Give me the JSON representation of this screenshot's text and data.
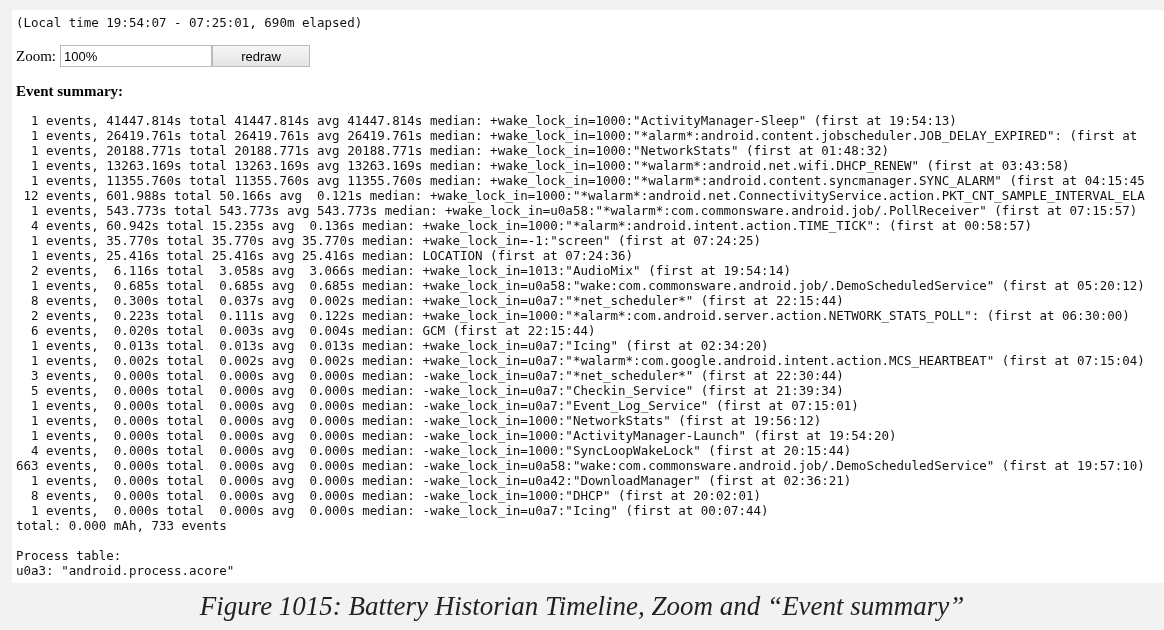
{
  "local_time": "(Local time 19:54:07 - 07:25:01, 690m elapsed)",
  "zoom": {
    "label": "Zoom:",
    "value": "100%",
    "button": "redraw"
  },
  "event_summary": {
    "heading": "Event summary:",
    "rows": [
      "  1 events, 41447.814s total 41447.814s avg 41447.814s median: +wake_lock_in=1000:\"ActivityManager-Sleep\" (first at 19:54:13)",
      "  1 events, 26419.761s total 26419.761s avg 26419.761s median: +wake_lock_in=1000:\"*alarm*:android.content.jobscheduler.JOB_DELAY_EXPIRED\": (first at",
      "  1 events, 20188.771s total 20188.771s avg 20188.771s median: +wake_lock_in=1000:\"NetworkStats\" (first at 01:48:32)",
      "  1 events, 13263.169s total 13263.169s avg 13263.169s median: +wake_lock_in=1000:\"*walarm*:android.net.wifi.DHCP_RENEW\" (first at 03:43:58)",
      "  1 events, 11355.760s total 11355.760s avg 11355.760s median: +wake_lock_in=1000:\"*walarm*:android.content.syncmanager.SYNC_ALARM\" (first at 04:15:45",
      " 12 events, 601.988s total 50.166s avg  0.121s median: +wake_lock_in=1000:\"*walarm*:android.net.ConnectivityService.action.PKT_CNT_SAMPLE_INTERVAL_ELA",
      "  1 events, 543.773s total 543.773s avg 543.773s median: +wake_lock_in=u0a58:\"*walarm*:com.commonsware.android.job/.PollReceiver\" (first at 07:15:57)",
      "  4 events, 60.942s total 15.235s avg  0.136s median: +wake_lock_in=1000:\"*alarm*:android.intent.action.TIME_TICK\": (first at 00:58:57)",
      "  1 events, 35.770s total 35.770s avg 35.770s median: +wake_lock_in=-1:\"screen\" (first at 07:24:25)",
      "  1 events, 25.416s total 25.416s avg 25.416s median: LOCATION (first at 07:24:36)",
      "  2 events,  6.116s total  3.058s avg  3.066s median: +wake_lock_in=1013:\"AudioMix\" (first at 19:54:14)",
      "  1 events,  0.685s total  0.685s avg  0.685s median: +wake_lock_in=u0a58:\"wake:com.commonsware.android.job/.DemoScheduledService\" (first at 05:20:12)",
      "  8 events,  0.300s total  0.037s avg  0.002s median: +wake_lock_in=u0a7:\"*net_scheduler*\" (first at 22:15:44)",
      "  2 events,  0.223s total  0.111s avg  0.122s median: +wake_lock_in=1000:\"*alarm*:com.android.server.action.NETWORK_STATS_POLL\": (first at 06:30:00)",
      "  6 events,  0.020s total  0.003s avg  0.004s median: GCM (first at 22:15:44)",
      "  1 events,  0.013s total  0.013s avg  0.013s median: +wake_lock_in=u0a7:\"Icing\" (first at 02:34:20)",
      "  1 events,  0.002s total  0.002s avg  0.002s median: +wake_lock_in=u0a7:\"*walarm*:com.google.android.intent.action.MCS_HEARTBEAT\" (first at 07:15:04)",
      "  3 events,  0.000s total  0.000s avg  0.000s median: -wake_lock_in=u0a7:\"*net_scheduler*\" (first at 22:30:44)",
      "  5 events,  0.000s total  0.000s avg  0.000s median: -wake_lock_in=u0a7:\"Checkin_Service\" (first at 21:39:34)",
      "  1 events,  0.000s total  0.000s avg  0.000s median: -wake_lock_in=u0a7:\"Event_Log_Service\" (first at 07:15:01)",
      "  1 events,  0.000s total  0.000s avg  0.000s median: -wake_lock_in=1000:\"NetworkStats\" (first at 19:56:12)",
      "  1 events,  0.000s total  0.000s avg  0.000s median: -wake_lock_in=1000:\"ActivityManager-Launch\" (first at 19:54:20)",
      "  4 events,  0.000s total  0.000s avg  0.000s median: -wake_lock_in=1000:\"SyncLoopWakeLock\" (first at 20:15:44)",
      "663 events,  0.000s total  0.000s avg  0.000s median: -wake_lock_in=u0a58:\"wake:com.commonsware.android.job/.DemoScheduledService\" (first at 19:57:10)",
      "  1 events,  0.000s total  0.000s avg  0.000s median: -wake_lock_in=u0a42:\"DownloadManager\" (first at 02:36:21)",
      "  8 events,  0.000s total  0.000s avg  0.000s median: -wake_lock_in=1000:\"DHCP\" (first at 20:02:01)",
      "  1 events,  0.000s total  0.000s avg  0.000s median: -wake_lock_in=u0a7:\"Icing\" (first at 00:07:44)"
    ],
    "total": "total: 0.000 mAh, 733 events"
  },
  "process_table": {
    "heading": "Process table:",
    "rows": [
      "u0a3: \"android.process.acore\""
    ]
  },
  "caption": "Figure 1015: Battery Historian Timeline, Zoom and “Event summary”"
}
